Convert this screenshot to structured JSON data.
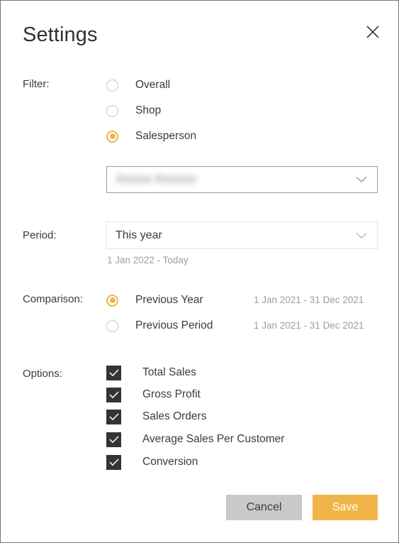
{
  "dialog": {
    "title": "Settings",
    "close_icon": "close-icon",
    "accent_color": "#f0b54a",
    "checkbox_color": "#333437",
    "cancel_color": "#c9c9c9",
    "muted_text_color": "#9d9ea1"
  },
  "filter": {
    "label": "Filter:",
    "options": [
      {
        "label": "Overall",
        "checked": false
      },
      {
        "label": "Shop",
        "checked": false
      },
      {
        "label": "Salesperson",
        "checked": true
      }
    ],
    "salesperson_select": {
      "value": "Xxxxxx Xxxxxxx",
      "redacted": true,
      "chevron_icon": "chevron-down-icon"
    }
  },
  "period": {
    "label": "Period:",
    "selected": "This year",
    "chevron_icon": "chevron-down-icon",
    "range_text": "1 Jan 2022 - Today"
  },
  "comparison": {
    "label": "Comparison:",
    "options": [
      {
        "label": "Previous Year",
        "checked": true,
        "range": "1 Jan 2021 - 31 Dec 2021"
      },
      {
        "label": "Previous Period",
        "checked": false,
        "range": "1 Jan 2021 - 31 Dec 2021"
      }
    ]
  },
  "options": {
    "label": "Options:",
    "items": [
      {
        "label": "Total Sales",
        "checked": true
      },
      {
        "label": "Gross Profit",
        "checked": true
      },
      {
        "label": "Sales Orders",
        "checked": true
      },
      {
        "label": "Average Sales Per Customer",
        "checked": true
      },
      {
        "label": "Conversion",
        "checked": true
      }
    ]
  },
  "footer": {
    "cancel_label": "Cancel",
    "save_label": "Save"
  }
}
